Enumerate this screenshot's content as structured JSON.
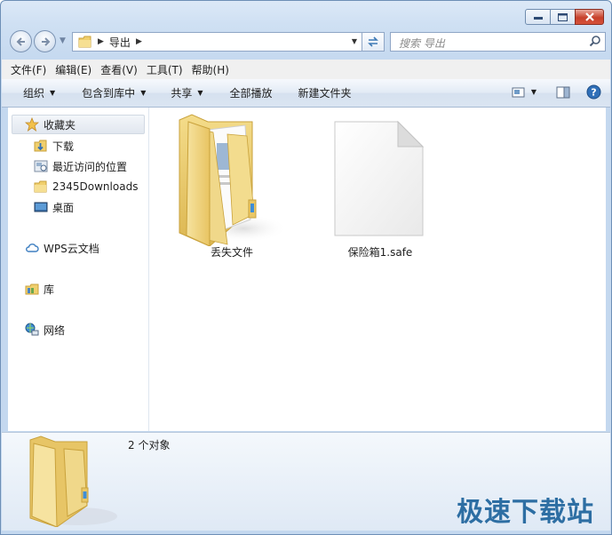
{
  "address": {
    "crumb": "导出"
  },
  "search": {
    "placeholder": "搜索 导出"
  },
  "menu": [
    "文件(F)",
    "编辑(E)",
    "查看(V)",
    "工具(T)",
    "帮助(H)"
  ],
  "toolbar": {
    "organize": "组织",
    "include_library": "包含到库中",
    "share": "共享",
    "play_all": "全部播放",
    "new_folder": "新建文件夹"
  },
  "nav": {
    "favorites": "收藏夹",
    "downloads": "下载",
    "recent": "最近访问的位置",
    "downloads2345": "2345Downloads",
    "desktop": "桌面",
    "wps": "WPS云文档",
    "libraries": "库",
    "network": "网络"
  },
  "files": [
    {
      "name": "丢失文件",
      "type": "folder"
    },
    {
      "name": "保险箱1.safe",
      "type": "file"
    }
  ],
  "details": {
    "count": "2 个对象"
  },
  "watermark": "极速下载站",
  "colors": {
    "titlebar": "#cfe0f3",
    "close_button": "#c7402b",
    "watermark": "#2d6ea3",
    "folder": "#f2d67c"
  }
}
